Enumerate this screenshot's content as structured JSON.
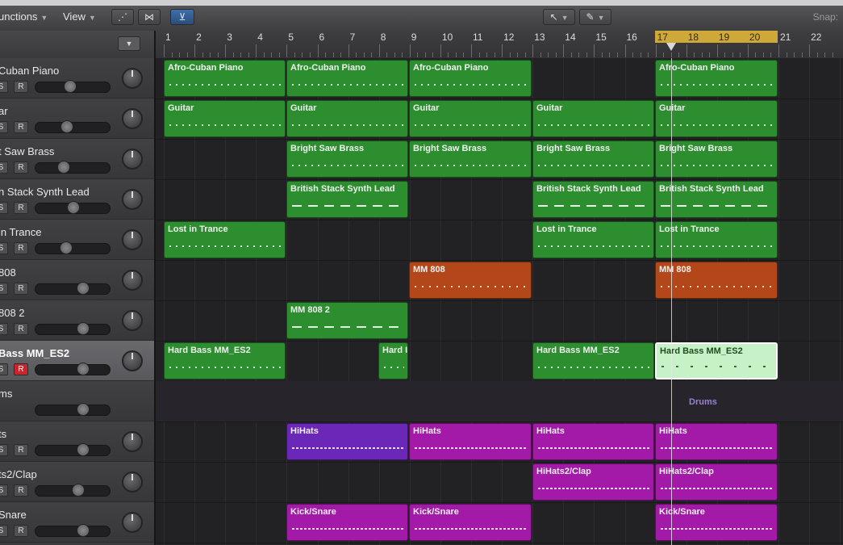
{
  "toolbar": {
    "functions_label": "unctions",
    "view_label": "View",
    "snap_label": "Snap:"
  },
  "ruler": {
    "bars": [
      "1",
      "2",
      "3",
      "4",
      "5",
      "6",
      "7",
      "8",
      "9",
      "10",
      "11",
      "12",
      "13",
      "14",
      "15",
      "16",
      "17",
      "18",
      "19",
      "20",
      "21",
      "22"
    ],
    "cycle": [
      "17",
      "20"
    ]
  },
  "tracks": [
    {
      "name": "Cuban Piano",
      "s": "S",
      "r": "R",
      "volume": 0.45
    },
    {
      "name": "ar",
      "s": "S",
      "r": "R",
      "volume": 0.4
    },
    {
      "name": "t Saw Brass",
      "s": "S",
      "r": "R",
      "volume": 0.35
    },
    {
      "name": "h Stack Synth Lead",
      "s": "S",
      "r": "R",
      "volume": 0.5
    },
    {
      "name": "in Trance",
      "s": "S",
      "r": "R",
      "volume": 0.38
    },
    {
      "name": "808",
      "s": "S",
      "r": "R",
      "volume": 0.65
    },
    {
      "name": "808 2",
      "s": "S",
      "r": "R",
      "volume": 0.65
    },
    {
      "name": "Bass MM_ES2",
      "s": "S",
      "r": "R",
      "volume": 0.65,
      "selected": true,
      "armed": true
    },
    {
      "name": "ms",
      "s": "",
      "r": "",
      "volume": 0.65
    },
    {
      "name": "ts",
      "s": "S",
      "r": "R",
      "volume": 0.65
    },
    {
      "name": "ts2/Clap",
      "s": "S",
      "r": "R",
      "volume": 0.58
    },
    {
      "name": "Snare",
      "s": "S",
      "r": "R",
      "volume": 0.65
    }
  ],
  "regions": {
    "afro1": "Afro-Cuban Piano",
    "afro2": "Afro-Cuban Piano",
    "afro3": "Afro-Cuban Piano",
    "afro4": "Afro-Cuban Piano",
    "guitar1": "Guitar",
    "guitar2": "Guitar",
    "guitar3": "Guitar",
    "guitar4": "Guitar",
    "guitar5": "Guitar",
    "brass1": "Bright Saw Brass",
    "brass2": "Bright Saw Brass",
    "brass3": "Bright Saw Brass",
    "brass4": "Bright Saw Brass",
    "lead1": "British Stack Synth Lead",
    "lead2": "British Stack Synth Lead",
    "lead3": "British Stack Synth Lead",
    "trance1": "Lost in Trance",
    "trance2": "Lost in Trance",
    "trance3": "Lost in Trance",
    "mm808a": "MM 808",
    "mm808b": "MM 808",
    "mm8082": "MM 808 2",
    "bass1": "Hard Bass MM_ES2",
    "bass2": "Hard I",
    "bass3": "Hard Bass MM_ES2",
    "bass4": "Hard Bass MM_ES2",
    "drums": "Drums",
    "hihats1": "HiHats",
    "hihats2": "HiHats",
    "hihats3": "HiHats",
    "hihats4": "HiHats",
    "clap1": "HiHats2/Clap",
    "clap2": "HiHats2/Clap",
    "kick1": "Kick/Snare",
    "kick2": "Kick/Snare",
    "kick3": "Kick/Snare"
  },
  "colors": {
    "region_green": "#2c8e2f",
    "region_orange": "#b4471a",
    "region_purple": "#6a27b8",
    "region_magenta": "#a41aa8",
    "cycle": "#cfa83a",
    "record": "#c9252b"
  }
}
